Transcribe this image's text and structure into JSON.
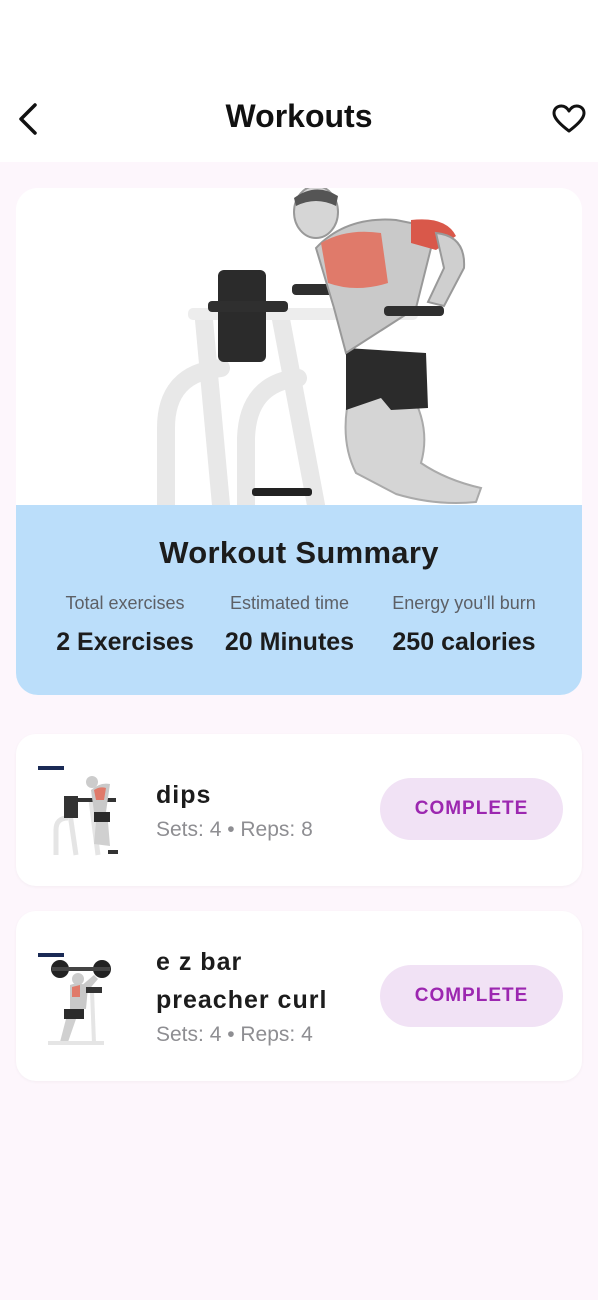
{
  "header": {
    "title": "Workouts",
    "back_icon": "chevron-left-icon",
    "favorite_icon": "heart-outline-icon"
  },
  "summary": {
    "title": "Workout Summary",
    "stats": [
      {
        "label": "Total exercises",
        "value": "2 Exercises"
      },
      {
        "label": "Estimated time",
        "value": "20 Minutes"
      },
      {
        "label": "Energy you'll burn",
        "value": "250 calories"
      }
    ]
  },
  "exercises": [
    {
      "name_lines": [
        "dips"
      ],
      "meta": "Sets: 4 • Reps: 8",
      "action": "COMPLETE"
    },
    {
      "name_lines": [
        "e z bar",
        "preacher curl"
      ],
      "meta": "Sets: 4 • Reps: 4",
      "action": "COMPLETE"
    }
  ],
  "colors": {
    "background": "#fdf6fc",
    "summary_bg": "#bbdefa",
    "button_bg": "#f1e2f5",
    "button_text": "#9c27b0"
  }
}
